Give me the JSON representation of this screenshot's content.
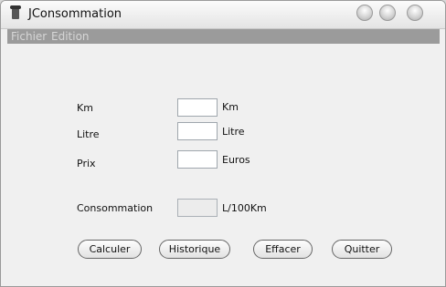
{
  "window": {
    "title": "JConsommation"
  },
  "menu": {
    "items": [
      "Fichier",
      "Edition"
    ]
  },
  "form": {
    "km": {
      "label": "Km",
      "value": "",
      "unit": "Km"
    },
    "litre": {
      "label": "Litre",
      "value": "",
      "unit": "Litre"
    },
    "prix": {
      "label": "Prix",
      "value": "",
      "unit": "Euros"
    },
    "consommation": {
      "label": "Consommation",
      "value": "",
      "unit": "L/100Km"
    }
  },
  "buttons": {
    "calculer": "Calculer",
    "historique": "Historique",
    "effacer": "Effacer",
    "quitter": "Quitter"
  }
}
